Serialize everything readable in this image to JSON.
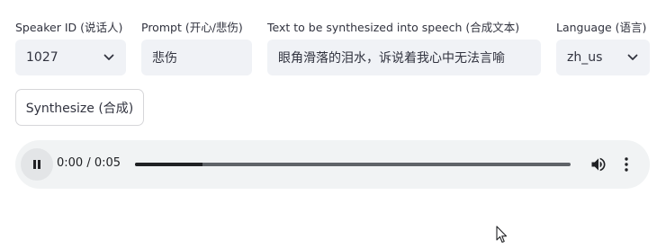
{
  "speaker": {
    "label": "Speaker ID (说话人)",
    "value": "1027"
  },
  "prompt": {
    "label": "Prompt (开心/悲伤)",
    "value": "悲伤"
  },
  "text": {
    "label": "Text to be synthesized into speech (合成文本)",
    "value": "眼角滑落的泪水，诉说着我心中无法言喻"
  },
  "language": {
    "label": "Language (语言)",
    "value": "zh_us"
  },
  "synthesize_button": {
    "label": "Synthesize (合成)"
  },
  "audio_player": {
    "time_display": "0:00 / 0:05",
    "progress_fraction": 0.155
  },
  "icons": {
    "dropdown": "chevron-down-icon",
    "pause": "pause-icon",
    "volume": "volume-icon",
    "menu": "more-vert-icon",
    "cursor": "mouse-cursor-icon"
  },
  "colors": {
    "field_bg": "#f0f2f6",
    "player_bg": "#f1f3f4",
    "text": "#31333f"
  }
}
